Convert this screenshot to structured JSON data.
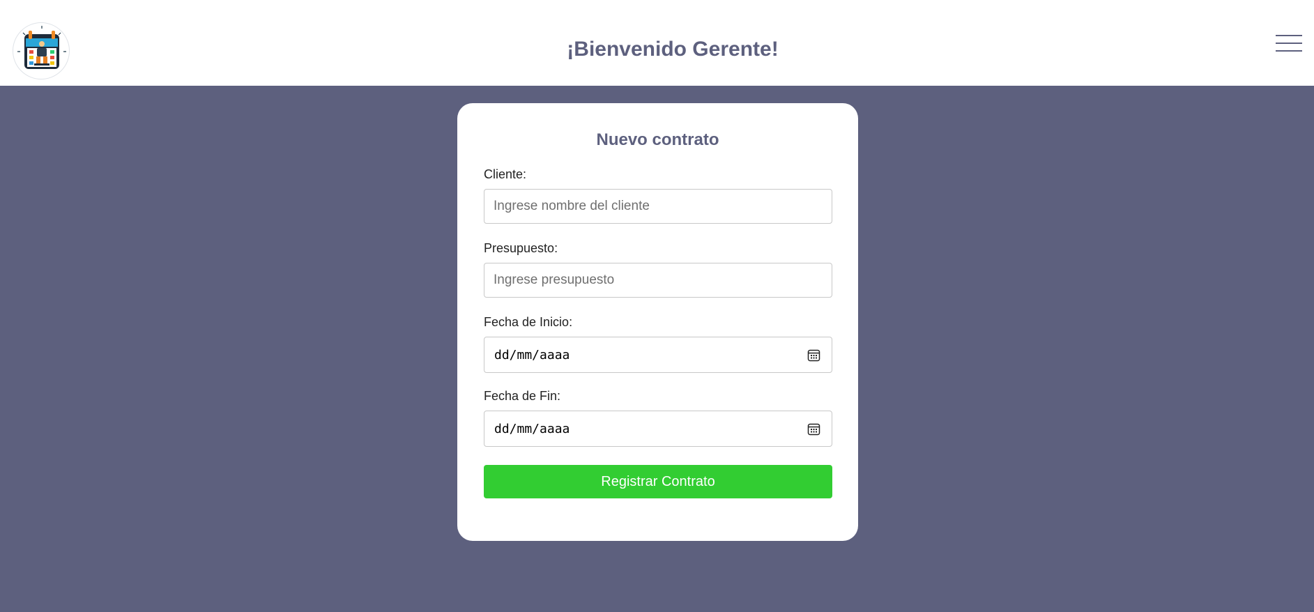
{
  "header": {
    "logo_icon": "calendar-worker-logo",
    "title": "¡Bienvenido Gerente!",
    "menu_icon": "hamburger-menu-icon"
  },
  "form": {
    "title": "Nuevo contrato",
    "cliente": {
      "label": "Cliente:",
      "value": "",
      "placeholder": "Ingrese nombre del cliente"
    },
    "presupuesto": {
      "label": "Presupuesto:",
      "value": "",
      "placeholder": "Ingrese presupuesto"
    },
    "fecha_inicio": {
      "label": "Fecha de Inicio:",
      "value": "dd/mm/aaaa",
      "icon": "calendar-icon"
    },
    "fecha_fin": {
      "label": "Fecha de Fin:",
      "value": "dd/mm/aaaa",
      "icon": "calendar-icon"
    },
    "submit_label": "Registrar Contrato"
  },
  "colors": {
    "background": "#5d607e",
    "accent_text": "#5d607e",
    "submit_button": "#32cd32",
    "card": "#ffffff"
  }
}
